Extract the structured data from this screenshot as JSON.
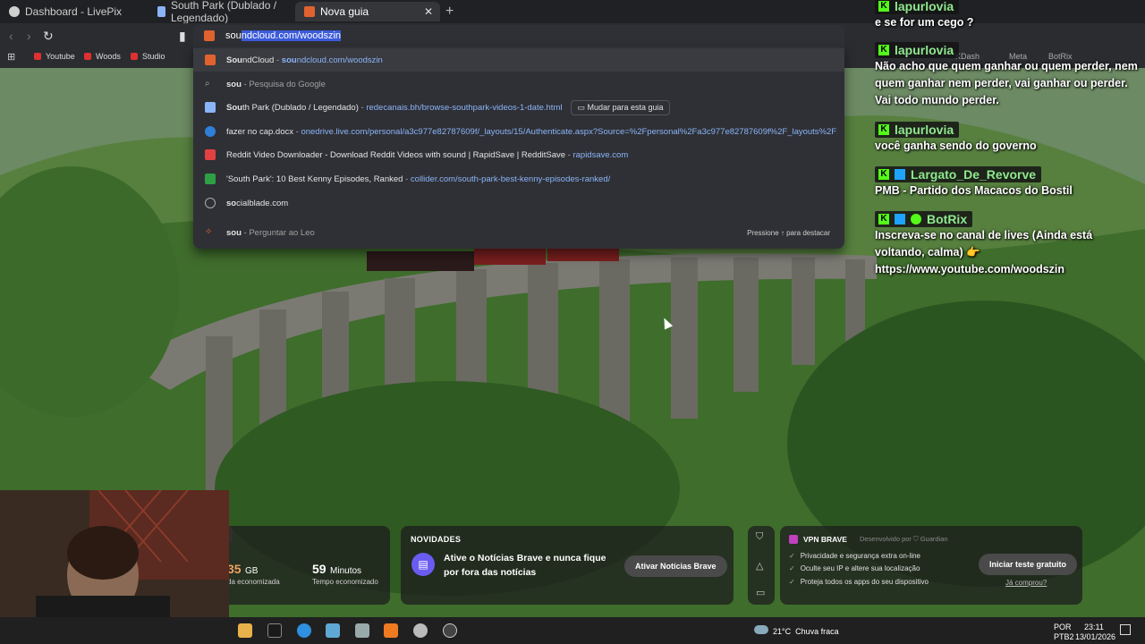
{
  "tabs": [
    {
      "title": "Dashboard - LivePix"
    },
    {
      "title": "South Park (Dublado / Legendado)"
    },
    {
      "title": "Nova guia"
    }
  ],
  "omnibox": {
    "typed": "sou",
    "autocomplete": "ndcloud.com/woodszin"
  },
  "bookmarks": [
    {
      "label": "Youtube"
    },
    {
      "label": "Woods"
    },
    {
      "label": "Studio"
    }
  ],
  "bookmarks_right": [
    "KDash",
    "Meta",
    "BotRix"
  ],
  "suggestions": [
    {
      "bold": "Sou",
      "rest": "ndCloud",
      "sep": " - ",
      "url_bold": "sou",
      "url_rest": "ndcloud.com/woodszin"
    },
    {
      "bold": "sou",
      "rest": "",
      "sep": " - ",
      "desc": "Pesquisa do Google"
    },
    {
      "bold": "Sou",
      "rest": "th Park (Dublado / Legendado)",
      "sep": " - ",
      "url": "redecanais.bh/browse-southpark-videos-1-date.html",
      "button": "Mudar para esta guia"
    },
    {
      "bold": "",
      "rest": "fazer no cap.docx",
      "sep": " - ",
      "url": "onedrive.live.com/personal/a3c977e82787609f/_layouts/15/Authenticate.aspx?Source=%2Fpersonal%2Fa3c977e82787609f%2F_layouts%2F15%2..."
    },
    {
      "bold": "",
      "rest": "Reddit Video Downloader - Download Reddit Videos with sound | RapidSave | RedditSave",
      "sep": " - ",
      "url": "rapidsave.com"
    },
    {
      "bold": "",
      "rest": "'South Park': 10 Best Kenny Episodes, Ranked",
      "sep": " - ",
      "url": "collider.com/south-park-best-kenny-episodes-ranked/"
    },
    {
      "bold": "so",
      "rest": "cialblade.com",
      "sep": "",
      "url": ""
    },
    {
      "bold": "sou",
      "rest": "",
      "sep": " - ",
      "desc": "Perguntar ao Leo"
    }
  ],
  "suggestion_hint": "Pressione ↑ para destacar",
  "chat": [
    {
      "user": "lapurlovia",
      "text": "e se for um cego ?"
    },
    {
      "user": "lapurlovia",
      "text": "Não acho que quem ganhar ou quem perder, nem quem ganhar nem perder, vai ganhar ou perder. Vai todo mundo perder."
    },
    {
      "user": "lapurlovia",
      "text": "você ganha sendo do governo"
    },
    {
      "user": "Largato_De_Revorve",
      "text": "PMB - Partido dos Macacos do Bostil"
    },
    {
      "user": "BotRix",
      "text": "Inscreva-se no canal de lives (Ainda está voltando, calma) 👉 https://www.youtube.com/woodszin"
    }
  ],
  "stats": {
    "data_value": "35",
    "data_unit": "GB",
    "data_label": "da economizada",
    "time_value": "59",
    "time_unit": "Minutos",
    "time_label": "Tempo economizado"
  },
  "news": {
    "title": "NOVIDADES",
    "text": "Ative o Notícias Brave e nunca fique por fora das notícias",
    "button": "Ativar Notícias Brave"
  },
  "vpn": {
    "title": "VPN BRAVE",
    "provider": "Desenvolvido por ⛉ Guardian",
    "items": [
      "Privacidade e segurança extra on-line",
      "Oculte seu IP e altere sua localização",
      "Proteja todos os apps do seu dispositivo"
    ],
    "button": "Iniciar teste gratuito",
    "link": "Já comprou?"
  },
  "taskbar": {
    "weather": "21°C  Chuva fraca",
    "lang1": "POR",
    "lang2": "PTB2",
    "time": "23:11",
    "date": "13/01/2026"
  }
}
